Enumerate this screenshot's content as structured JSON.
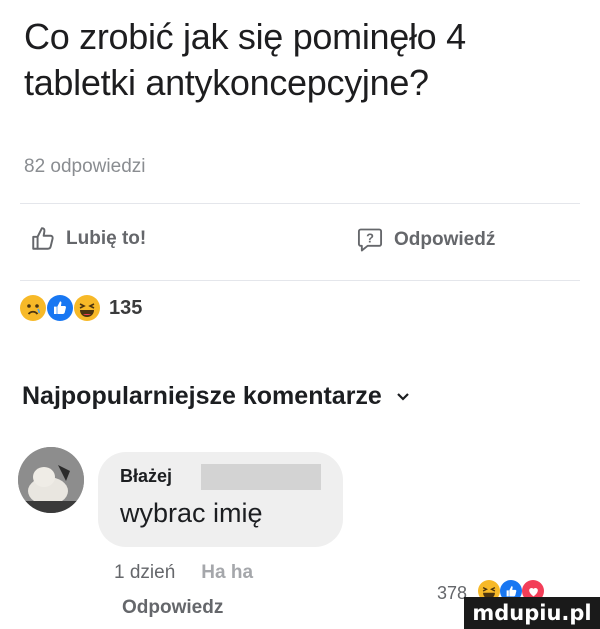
{
  "post": {
    "question": "Co zrobić jak się pominęło 4 tabletki antykoncepcyjne?",
    "answers_count": "82 odpowiedzi"
  },
  "actions": {
    "like_label": "Lubię to!",
    "reply_label": "Odpowiedź"
  },
  "reactions": {
    "icons": [
      "sad-icon",
      "like-icon",
      "haha-icon"
    ],
    "count": "135"
  },
  "comments_section": {
    "title": "Najpopularniejsze komentarze",
    "comment": {
      "author": "Błażej",
      "text": "wybrac imię",
      "time": "1 dzień",
      "haha_label": "Ha ha",
      "reply_label": "Odpowiedz",
      "reaction_count": "378",
      "reaction_icons": [
        "haha-icon",
        "like-icon",
        "love-icon"
      ]
    }
  },
  "watermark": "mdupiu.pl",
  "colors": {
    "like_blue": "#1877f2",
    "emoji_yellow": "#f7b928",
    "love_red": "#f33e58",
    "secondary_text": "#65676b"
  }
}
